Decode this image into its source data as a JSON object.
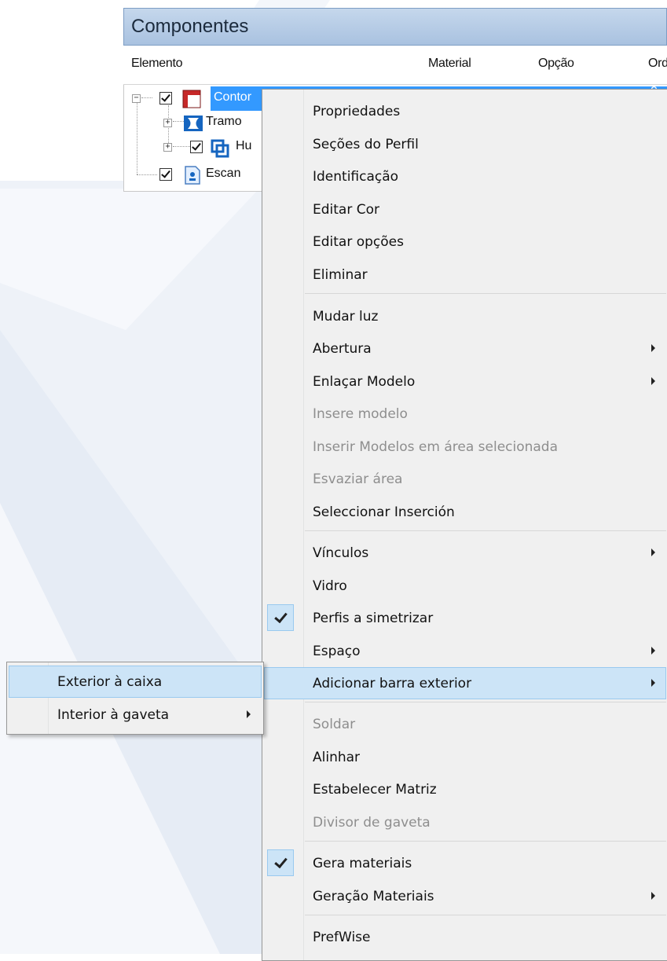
{
  "panel": {
    "title": "Componentes",
    "columns": [
      "Elemento",
      "Material",
      "Opção",
      "Ord"
    ]
  },
  "tree": [
    {
      "label": "Contor",
      "checked": true,
      "expander": "−",
      "icon": "profile-frame-icon",
      "selected": true,
      "extra": "0"
    },
    {
      "label": "Tramo",
      "checked": false,
      "expander": "+",
      "icon": "tramo-icon",
      "selected": false
    },
    {
      "label": "Hu",
      "checked": true,
      "expander": "+",
      "icon": "hollow-icon",
      "selected": false
    },
    {
      "label": "Escan",
      "checked": true,
      "expander": "",
      "icon": "escandallo-icon",
      "selected": false
    }
  ],
  "menu": {
    "items": [
      {
        "label": "Propriedades"
      },
      {
        "label": "Seções do Perfil"
      },
      {
        "label": "Identificação"
      },
      {
        "label": "Editar Cor"
      },
      {
        "label": "Editar opções"
      },
      {
        "label": "Eliminar"
      },
      {
        "label": "Mudar luz"
      },
      {
        "label": "Abertura"
      },
      {
        "label": "Enlaçar Modelo"
      },
      {
        "label": "Insere modelo"
      },
      {
        "label": "Inserir Modelos em área selecionada"
      },
      {
        "label": "Esvaziar área"
      },
      {
        "label": "Seleccionar Inserción"
      },
      {
        "label": "Vínculos"
      },
      {
        "label": "Vidro"
      },
      {
        "label": "Perfis a simetrizar"
      },
      {
        "label": "Espaço"
      },
      {
        "label": "Adicionar barra exterior"
      },
      {
        "label": "Soldar"
      },
      {
        "label": "Alinhar"
      },
      {
        "label": "Estabelecer Matriz"
      },
      {
        "label": "Divisor de gaveta"
      },
      {
        "label": "Gera materiais"
      },
      {
        "label": "Geração Materiais"
      },
      {
        "label": "PrefWise"
      }
    ]
  },
  "submenu": {
    "items": [
      {
        "label": "Exterior à caixa"
      },
      {
        "label": "Interior à gaveta"
      }
    ]
  }
}
